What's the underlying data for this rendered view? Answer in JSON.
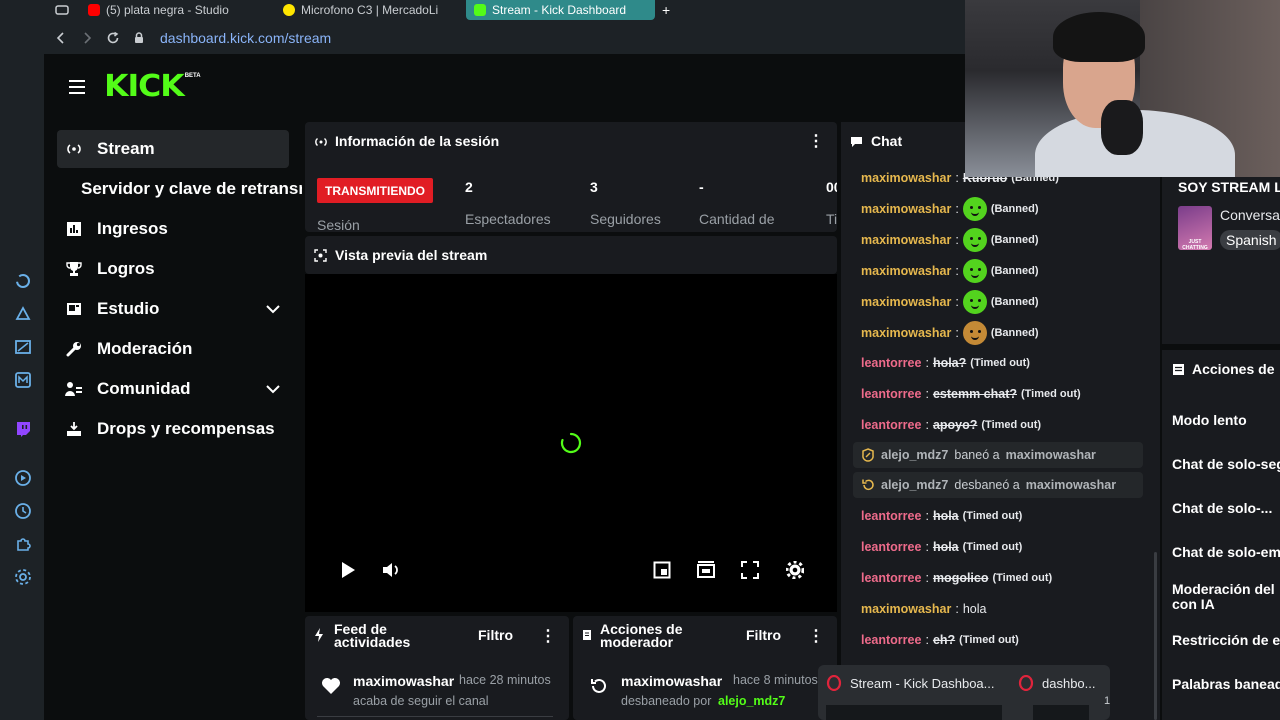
{
  "browser": {
    "tabs": [
      {
        "label": "(5) plata negra - Studio"
      },
      {
        "label": "Microfono C3 | MercadoLi"
      },
      {
        "label": "Stream - Kick Dashboard"
      }
    ],
    "new_tab": "+",
    "url_host": "dashboard.kick.com",
    "url_path": "/stream"
  },
  "logo": {
    "text": "KICK",
    "beta": "BETA"
  },
  "sidebar": {
    "items": [
      {
        "label": "Stream"
      },
      {
        "label": "Servidor y clave de retransmisión"
      },
      {
        "label": "Ingresos"
      },
      {
        "label": "Logros"
      },
      {
        "label": "Estudio"
      },
      {
        "label": "Moderación"
      },
      {
        "label": "Comunidad"
      },
      {
        "label": "Drops y recompensas"
      }
    ]
  },
  "session": {
    "title": "Información de la sesión",
    "status": "TRANSMITIENDO",
    "session_label": "Sesión",
    "stats": [
      {
        "value": "2",
        "label": "Espectadores"
      },
      {
        "value": "3",
        "label": "Seguidores"
      },
      {
        "value": "-",
        "label": "Cantidad de"
      },
      {
        "value": "00",
        "label": "Ti"
      }
    ]
  },
  "preview": {
    "title": "Vista previa del stream"
  },
  "activity": {
    "title_line1": "Feed de",
    "title_line2": "actividades",
    "filter": "Filtro",
    "item_user": "maximowashar",
    "item_time": "hace 28 minutos",
    "item_text": "acaba de seguir el canal"
  },
  "modactions": {
    "title_line1": "Acciones de",
    "title_line2": "moderador",
    "filter": "Filtro",
    "item_user": "maximowashar",
    "item_time": "hace 8 minutos",
    "item_text": "desbaneado por",
    "item_by": "alejo_mdz7"
  },
  "chat": {
    "title": "Chat",
    "messages": [
      {
        "user": "maximowashar",
        "text": "Kuoruo",
        "tag": "(Banned)"
      },
      {
        "user": "maximowashar",
        "tag": "(Banned)"
      },
      {
        "user": "maximowashar",
        "tag": "(Banned)"
      },
      {
        "user": "maximowashar",
        "tag": "(Banned)"
      },
      {
        "user": "maximowashar",
        "tag": "(Banned)"
      },
      {
        "user": "maximowashar",
        "tag": "(Banned)"
      },
      {
        "user": "leantorree",
        "text": "hola?",
        "tag": "(Timed out)"
      },
      {
        "user": "leantorree",
        "text": "estemm chat?",
        "tag": "(Timed out)"
      },
      {
        "user": "leantorree",
        "text": "apoyo?",
        "tag": "(Timed out)"
      },
      {
        "mod": "alejo_mdz7",
        "action": "baneó a",
        "target": "maximowashar"
      },
      {
        "mod": "alejo_mdz7",
        "action": "desbaneó a",
        "target": "maximowashar"
      },
      {
        "user": "leantorree",
        "text": "hola",
        "tag": "(Timed out)"
      },
      {
        "user": "leantorree",
        "text": "hola",
        "tag": "(Timed out)"
      },
      {
        "user": "leantorree",
        "text": "mogolico",
        "tag": "(Timed out)"
      },
      {
        "user": "maximowashar",
        "text": "hola"
      },
      {
        "user": "leantorree",
        "text": "eh?",
        "tag": "(Timed out)"
      }
    ],
    "sep": ":"
  },
  "stream_info": {
    "title": "SOY STREAM L",
    "category": "Conversa",
    "language": "Spanish",
    "thumb": "JUST CHATTING"
  },
  "chat_actions": {
    "title": "Acciones de",
    "items": [
      {
        "label": "Modo lento"
      },
      {
        "label": "Chat de solo-seg"
      },
      {
        "label": "Chat de solo-..."
      },
      {
        "label": "Chat de solo-em"
      },
      {
        "label": "Moderación del",
        "label2": "con IA"
      },
      {
        "label": "Restricción de e"
      },
      {
        "label": "Palabras banead"
      }
    ]
  },
  "taskbar": {
    "items": [
      {
        "label": "Stream - Kick Dashboa..."
      },
      {
        "label": "dashbo..."
      }
    ],
    "count": "1"
  },
  "colors": {
    "kick_green": "#53fc18",
    "live_red": "#e11d24",
    "panel": "#191b1f"
  }
}
